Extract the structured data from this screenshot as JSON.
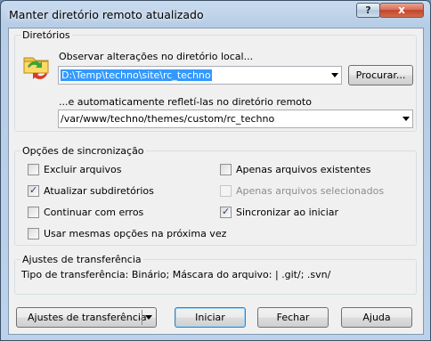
{
  "window": {
    "title": "Manter diretório remoto atualizado",
    "help_label": "?",
    "close_label": "x"
  },
  "directories": {
    "legend": "Diretórios",
    "local_label": "Observar alterações no diretório local...",
    "local_value": "D:\\Temp\\techno\\site\\rc_techno",
    "browse_label": "Procurar...",
    "remote_label": "...e automaticamente refletí-las no diretório remoto",
    "remote_value": "/var/www/techno/themes/custom/rc_techno"
  },
  "sync_options": {
    "legend": "Opções de sincronização",
    "delete_files": {
      "label": "Excluir arquivos",
      "checked": false,
      "enabled": true
    },
    "existing_only": {
      "label": "Apenas arquivos existentes",
      "checked": false,
      "enabled": true
    },
    "update_subdirs": {
      "label": "Atualizar subdiretórios",
      "checked": true,
      "enabled": true
    },
    "selected_only": {
      "label": "Apenas arquivos selecionados",
      "checked": false,
      "enabled": false
    },
    "continue_on_error": {
      "label": "Continuar com erros",
      "checked": false,
      "enabled": true
    },
    "sync_on_start": {
      "label": "Sincronizar ao iniciar",
      "checked": true,
      "enabled": true
    },
    "use_same_next_time": {
      "label": "Usar mesmas opções na próxima vez",
      "checked": false,
      "enabled": true
    }
  },
  "transfer_settings": {
    "legend": "Ajustes de transferência",
    "summary": "Tipo de transferência: Binário; Máscara do arquivo: | .git/; .svn/"
  },
  "buttons": {
    "transfer_settings": "Ajustes de transferência",
    "start": "Iniciar",
    "close": "Fechar",
    "help": "Ajuda"
  },
  "icons": {
    "sync_folders": "sync-folders-icon",
    "check_mark": "✓"
  }
}
